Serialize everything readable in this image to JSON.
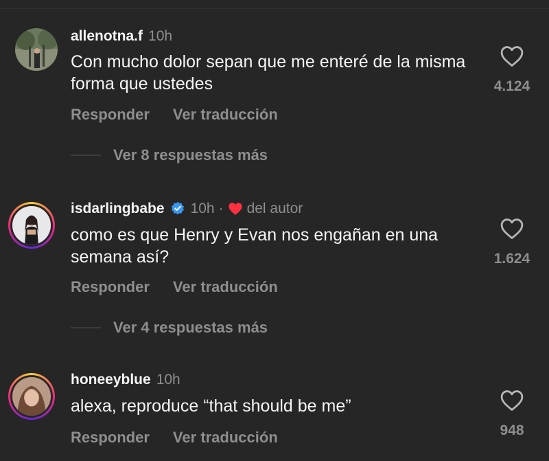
{
  "comments": [
    {
      "username": "allenotna.f",
      "time": "10h",
      "text": "Con mucho dolor sepan que me enteré de la misma forma que ustedes",
      "likes": "4.124",
      "reply_label": "Responder",
      "translate_label": "Ver traducción",
      "more_replies": "Ver 8 respuestas más"
    },
    {
      "username": "isdarlingbabe",
      "verified": true,
      "time": "10h",
      "separator": "·",
      "author_label": "del autor",
      "text": "como es que Henry y Evan nos engañan en una semana así?",
      "likes": "1.624",
      "reply_label": "Responder",
      "translate_label": "Ver traducción",
      "more_replies": "Ver 4 respuestas más"
    },
    {
      "username": "honeeyblue",
      "time": "10h",
      "text": "alexa, reproduce “that should be me”",
      "likes": "948",
      "reply_label": "Responder",
      "translate_label": "Ver traducción"
    }
  ],
  "colors": {
    "background": "#262626",
    "primary_text": "#f5f5f5",
    "secondary_text": "#8e8e8e",
    "verified_blue": "#3897f0",
    "author_heart": "#ff3040"
  },
  "icons": {
    "like": "heart-outline-icon",
    "verified": "verified-badge-icon",
    "author_liked": "heart-filled-icon"
  }
}
